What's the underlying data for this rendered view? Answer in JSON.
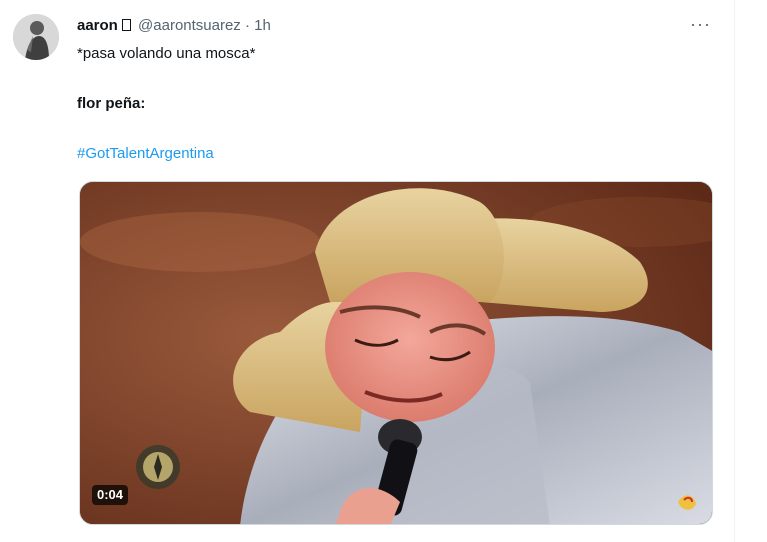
{
  "tweet": {
    "author_name": "aaron",
    "badge_glyph": "▯",
    "handle": "@aarontsuarez",
    "separator": "·",
    "time": "1h",
    "more_glyph": "···",
    "line1": "*pasa volando una mosca*",
    "line2": "flor peña:",
    "hashtag": "#GotTalentArgentina"
  },
  "media": {
    "type": "video",
    "duration": "0:04"
  },
  "colors": {
    "link": "#1d9bf0",
    "secondary_text": "#536471",
    "video_bg": "#7a3a22"
  }
}
